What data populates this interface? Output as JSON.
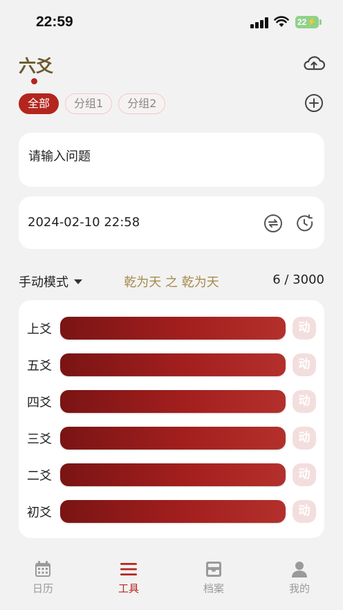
{
  "status_bar": {
    "time": "22:59",
    "battery": "22"
  },
  "header": {
    "title": "六爻"
  },
  "group_tabs": [
    {
      "label": "全部",
      "active": true
    },
    {
      "label": "分组1",
      "active": false
    },
    {
      "label": "分组2",
      "active": false
    }
  ],
  "question": {
    "placeholder": "请输入问题",
    "value": ""
  },
  "datetime": {
    "value": "2024-02-10 22:58"
  },
  "mode": {
    "label": "手动模式",
    "hexagram": "乾为天 之 乾为天",
    "count": "6 / 3000"
  },
  "yao_lines": [
    {
      "label": "上爻",
      "type": "yang",
      "move_label": "动"
    },
    {
      "label": "五爻",
      "type": "yang",
      "move_label": "动"
    },
    {
      "label": "四爻",
      "type": "yang",
      "move_label": "动"
    },
    {
      "label": "三爻",
      "type": "yang",
      "move_label": "动"
    },
    {
      "label": "二爻",
      "type": "yang",
      "move_label": "动"
    },
    {
      "label": "初爻",
      "type": "yang",
      "move_label": "动"
    }
  ],
  "tab_bar": [
    {
      "label": "日历",
      "icon": "calendar-icon",
      "active": false
    },
    {
      "label": "工具",
      "icon": "menu-icon",
      "active": true
    },
    {
      "label": "档案",
      "icon": "archive-icon",
      "active": false
    },
    {
      "label": "我的",
      "icon": "user-icon",
      "active": false
    }
  ],
  "colors": {
    "accent": "#b3261e",
    "title": "#6b5a2c",
    "hexagram": "#a68a4e",
    "background": "#f2f2f2"
  }
}
